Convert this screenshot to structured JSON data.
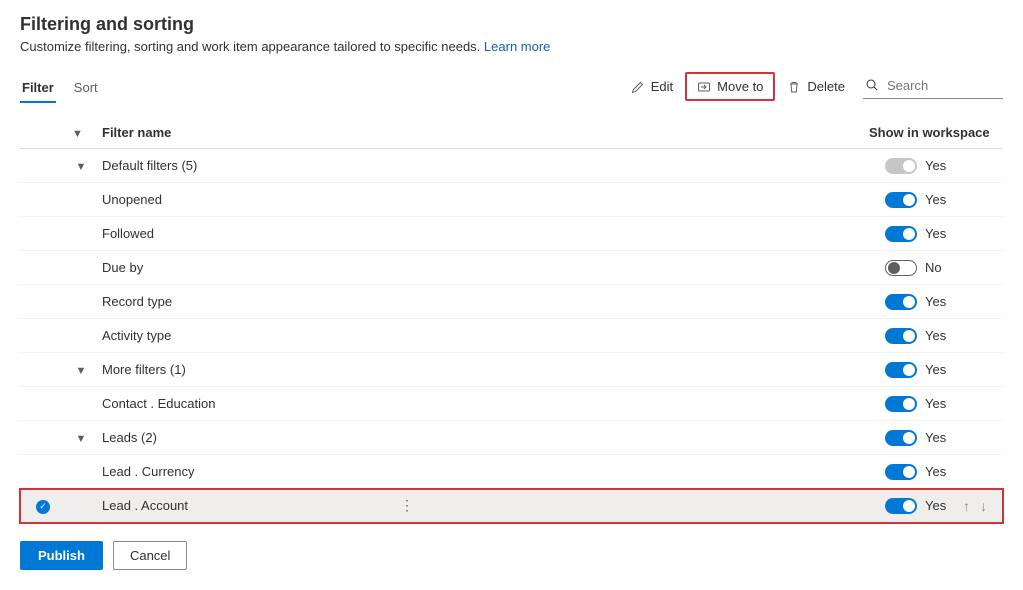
{
  "header": {
    "title": "Filtering and sorting",
    "subtitle": "Customize filtering, sorting and work item appearance tailored to specific needs.",
    "learn_more": "Learn more"
  },
  "tabs": {
    "filter": "Filter",
    "sort": "Sort"
  },
  "commands": {
    "edit": "Edit",
    "move_to": "Move to",
    "delete": "Delete",
    "search_placeholder": "Search"
  },
  "columns": {
    "name": "Filter name",
    "show": "Show in workspace"
  },
  "toggle_labels": {
    "yes": "Yes",
    "no": "No"
  },
  "rows": [
    {
      "name": "Default filters (5)",
      "group": true,
      "indent": 0,
      "on": true,
      "disabled": true
    },
    {
      "name": "Unopened",
      "group": false,
      "indent": 1,
      "on": true
    },
    {
      "name": "Followed",
      "group": false,
      "indent": 1,
      "on": true
    },
    {
      "name": "Due by",
      "group": false,
      "indent": 1,
      "on": false
    },
    {
      "name": "Record type",
      "group": false,
      "indent": 1,
      "on": true
    },
    {
      "name": "Activity type",
      "group": false,
      "indent": 1,
      "on": true
    },
    {
      "name": "More filters (1)",
      "group": true,
      "indent": 0,
      "on": true
    },
    {
      "name": "Contact . Education",
      "group": false,
      "indent": 1,
      "on": true
    },
    {
      "name": "Leads (2)",
      "group": true,
      "indent": 0,
      "on": true
    },
    {
      "name": "Lead . Currency",
      "group": false,
      "indent": 1,
      "on": true
    },
    {
      "name": "Lead . Account",
      "group": false,
      "indent": 1,
      "on": true,
      "selected": true
    }
  ],
  "footer": {
    "publish": "Publish",
    "cancel": "Cancel"
  }
}
